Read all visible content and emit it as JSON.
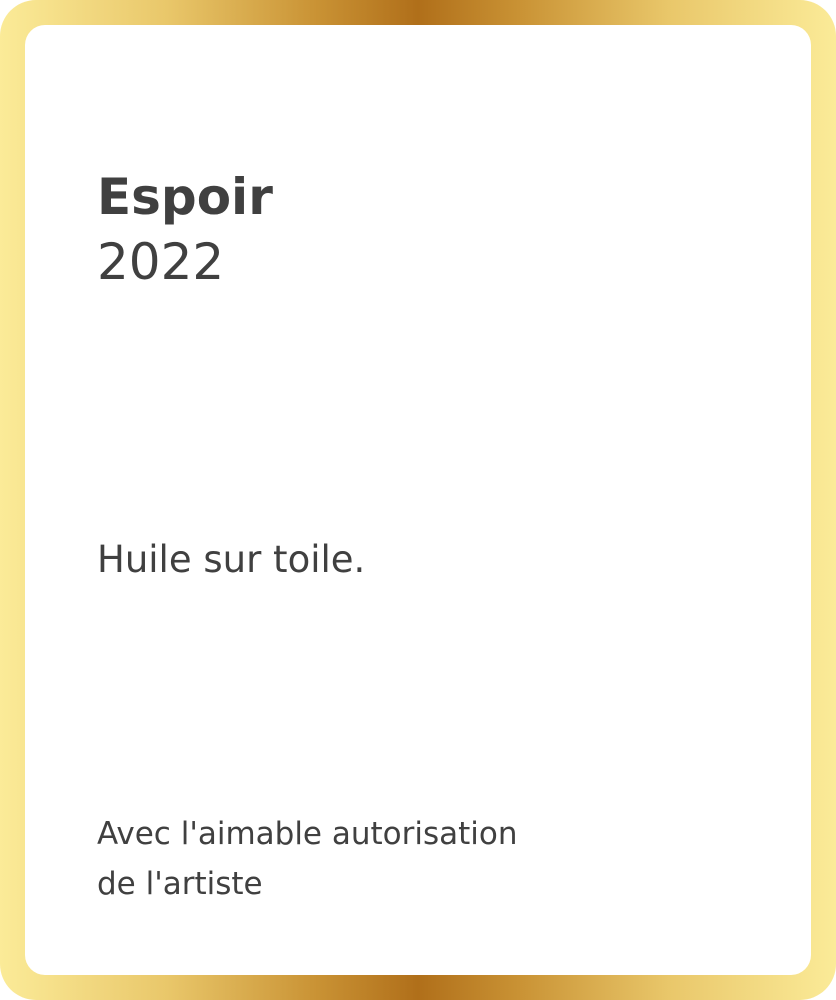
{
  "artwork": {
    "title": "Espoir",
    "year": "2022",
    "medium": "Huile sur toile.",
    "credit_line_1": "Avec l'aimable autorisation",
    "credit_line_2": "de l'artiste"
  },
  "colors": {
    "text": "#404040",
    "card_background": "#ffffff",
    "frame_gold_light": "#fbeb98",
    "frame_gold_dark": "#b06f1a"
  }
}
